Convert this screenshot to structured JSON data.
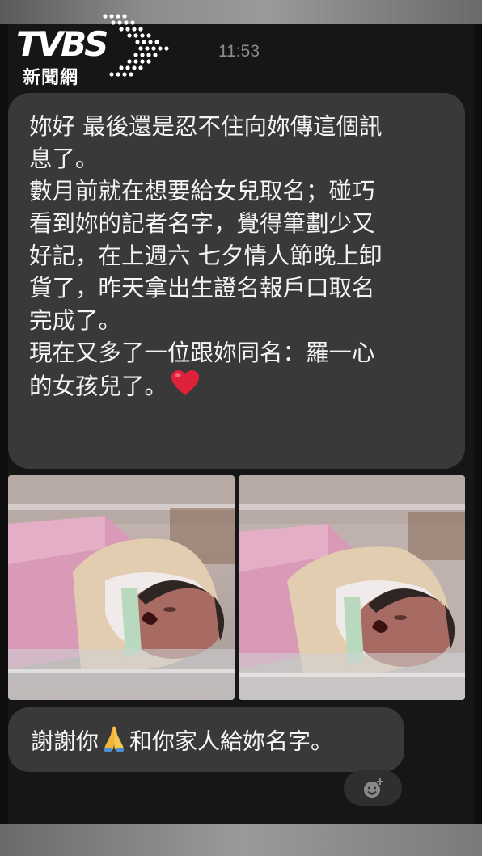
{
  "logo": {
    "brand_text": "TVBS",
    "sub_text": "新聞網"
  },
  "status": {
    "time": "11:53"
  },
  "messages": [
    {
      "lines": [
        "妳好 最後還是忍不住向妳傳這個訊",
        "息了。",
        "數月前就在想要給女兒取名；碰巧",
        "看到妳的記者名字，覺得筆劃少又",
        "好記，在上週六 七夕情人節晚上卸",
        "貨了，昨天拿出生證名報戶口取名",
        "完成了。",
        "現在又多了一位跟妳同名：羅一心",
        "的女孩兒了。"
      ],
      "trailing_emoji": "red-heart-icon"
    },
    {
      "photos": [
        "newborn-baby-photo",
        "newborn-baby-photo"
      ]
    },
    {
      "text_before": "謝謝你",
      "emoji": "folded-hands-icon",
      "text_after": "和你家人給妳名字。"
    }
  ],
  "reaction_button": {
    "icon": "add-reaction-icon"
  },
  "colors": {
    "background": "#161616",
    "bubble": "#393939",
    "text": "#f4f4f4",
    "time": "#8c8c8c",
    "heart": "#e0213a"
  }
}
